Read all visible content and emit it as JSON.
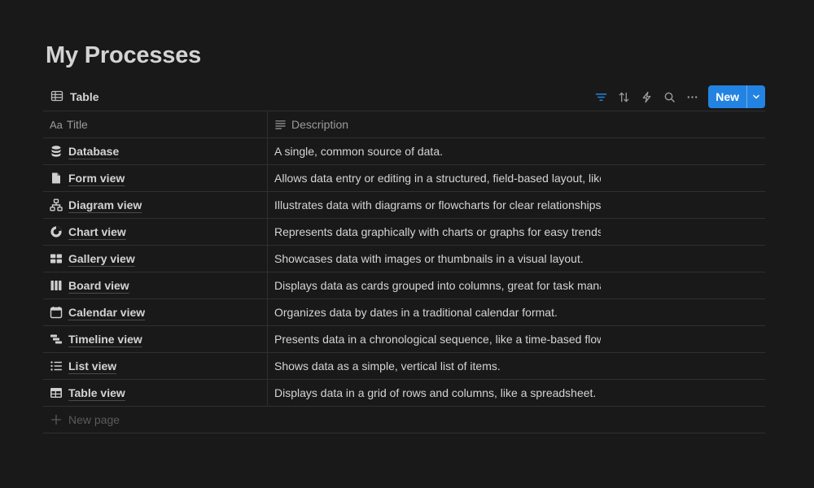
{
  "page": {
    "title": "My Processes"
  },
  "toolbar": {
    "view_label": "Table",
    "view_icon": "table-icon",
    "tools": [
      "filter-icon",
      "sort-icon",
      "automation-icon",
      "search-icon",
      "more-icon"
    ],
    "new_label": "New",
    "accent": "#2383e2"
  },
  "table": {
    "columns": [
      {
        "label": "Title",
        "prefix": "Aa"
      },
      {
        "label": "Description",
        "icon": "text-lines-icon"
      }
    ],
    "rows": [
      {
        "icon": "database-icon",
        "title": "Database",
        "description": "A single, common source of data."
      },
      {
        "icon": "form-icon",
        "title": "Form view",
        "description": "Allows data entry or editing in a structured, field-based layout, like"
      },
      {
        "icon": "diagram-icon",
        "title": "Diagram view",
        "description": "Illustrates data with diagrams or flowcharts for clear relationships"
      },
      {
        "icon": "chart-icon",
        "title": "Chart view",
        "description": "Represents data graphically with charts or graphs for easy trends."
      },
      {
        "icon": "gallery-icon",
        "title": "Gallery view",
        "description": "Showcases data with images or thumbnails in a visual layout."
      },
      {
        "icon": "board-icon",
        "title": "Board view",
        "description": "Displays data as cards grouped into columns, great for task mana"
      },
      {
        "icon": "calendar-icon",
        "title": "Calendar view",
        "description": "Organizes data by dates in a traditional calendar format."
      },
      {
        "icon": "timeline-icon",
        "title": "Timeline view",
        "description": "Presents data in a chronological sequence, like a time-based flow."
      },
      {
        "icon": "list-icon",
        "title": "List view",
        "description": "Shows data as a simple, vertical list of items."
      },
      {
        "icon": "table-view-icon",
        "title": "Table view",
        "description": "Displays data in a grid of rows and columns, like a spreadsheet."
      }
    ],
    "new_page_label": "New page"
  }
}
